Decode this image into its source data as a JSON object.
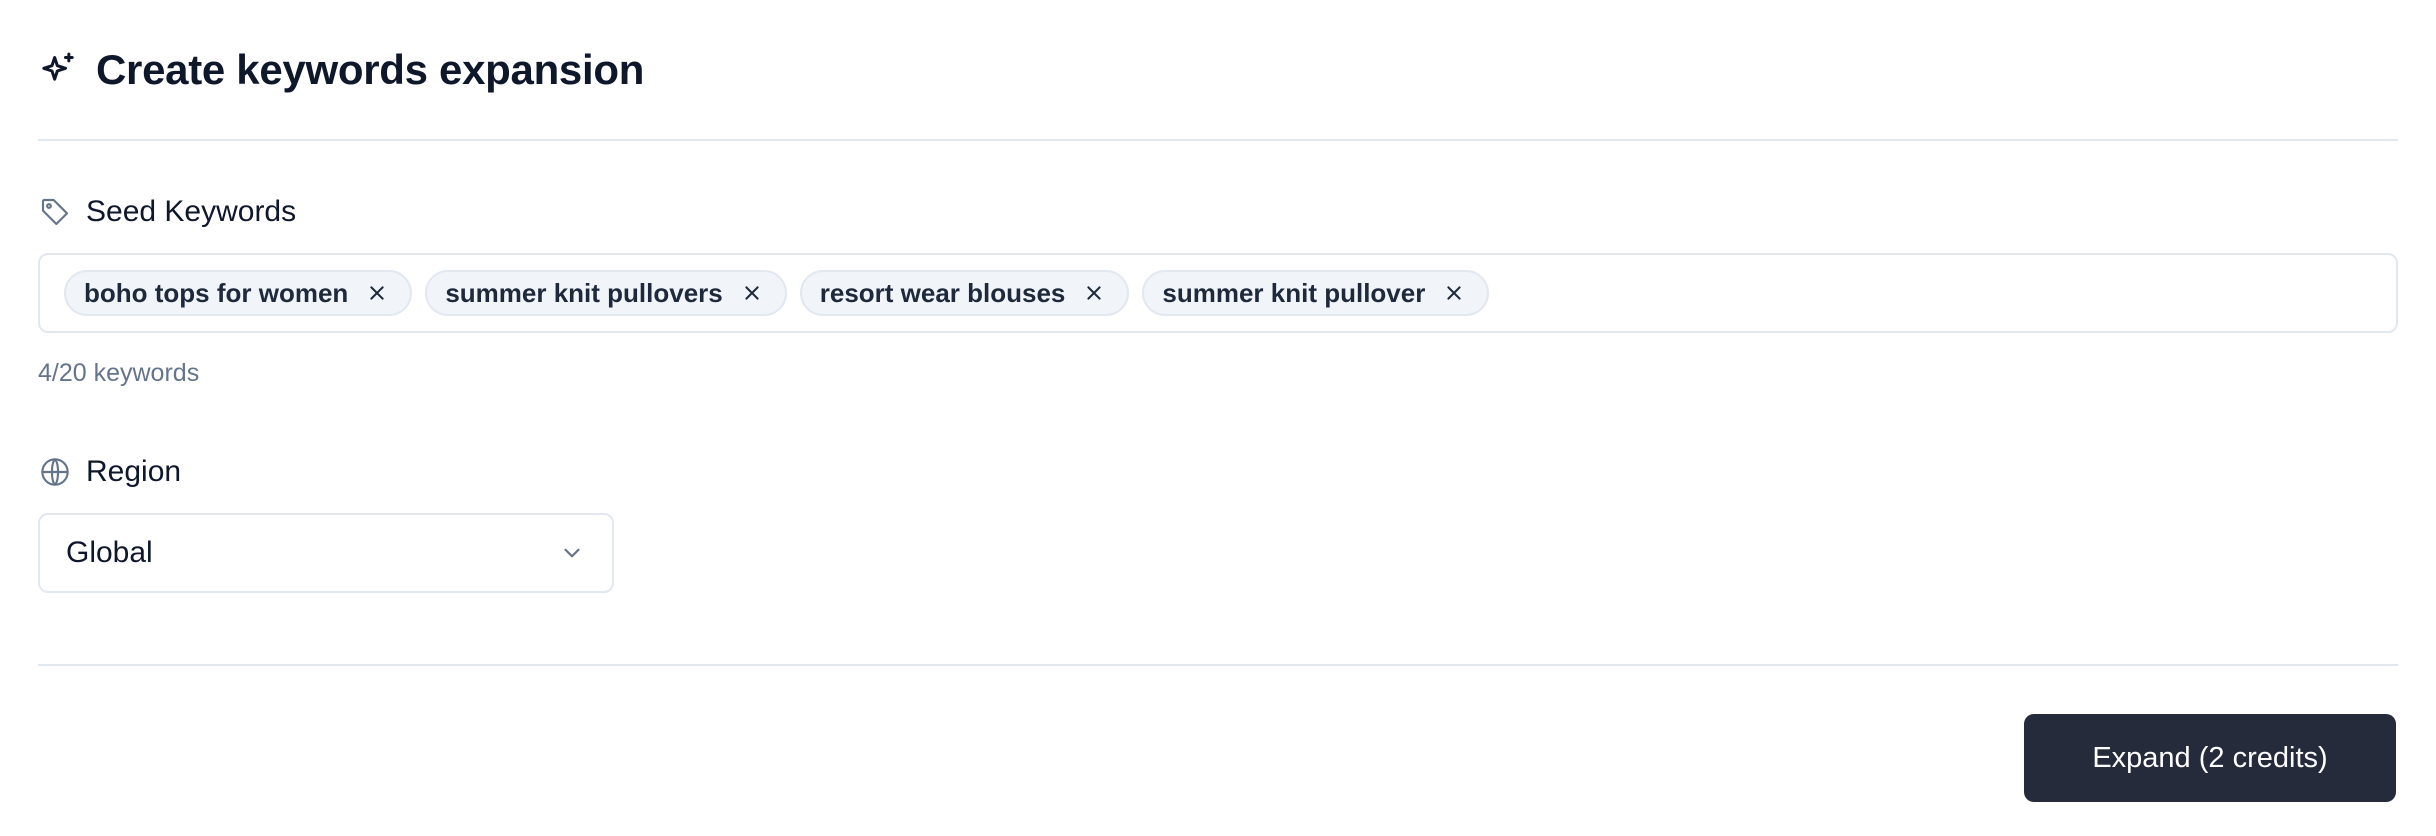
{
  "header": {
    "title": "Create keywords expansion",
    "icon": "sparkles-icon"
  },
  "seed": {
    "label": "Seed Keywords",
    "icon": "tag-icon",
    "chips": [
      {
        "text": "boho tops for women"
      },
      {
        "text": "summer knit pullovers"
      },
      {
        "text": "resort wear blouses"
      },
      {
        "text": "summer knit pullover"
      }
    ],
    "counter": "4/20 keywords"
  },
  "region": {
    "label": "Region",
    "icon": "globe-icon",
    "selected": "Global"
  },
  "actions": {
    "expand_label": "Expand (2 credits)"
  },
  "colors": {
    "primary_button": "#252b3b",
    "chip_background": "#f1f5f9",
    "border": "#e2e8f0",
    "muted_text": "#64748b"
  }
}
